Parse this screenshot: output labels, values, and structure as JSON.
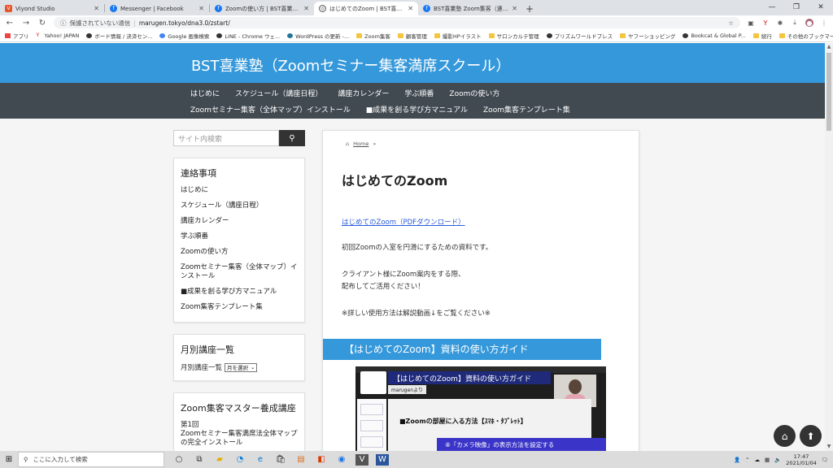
{
  "browser": {
    "tabs": [
      {
        "title": "Viyond Studio",
        "favicon": "V",
        "color": "#e8552d",
        "active": false
      },
      {
        "title": "Messenger | Facebook",
        "favicon": "f",
        "color": "#1877f2",
        "active": false
      },
      {
        "title": "Zoomの使い方 | BST喜業塾（Zoo",
        "favicon": "f",
        "color": "#1877f2",
        "active": false
      },
      {
        "title": "はじめてのZoom | BST喜業塾（Zo",
        "favicon": "◎",
        "color": "#555555",
        "active": true
      },
      {
        "title": "BST喜業塾 Zoom集客（連裂ニコ",
        "favicon": "f",
        "color": "#1877f2",
        "active": false
      }
    ],
    "security": "保護されていない通信",
    "url": "marugen.tokyo/dna3.0/zstart/",
    "bookmarks": [
      "アプリ",
      "Yahoo! JAPAN",
      "ボード情報 / 決済セン...",
      "Google 画像検索",
      "LINE - Chrome ウェ...",
      "WordPress の更新 -...",
      "Zoom集客",
      "顧客管理",
      "撮影HPイラスト",
      "サロンカルテ管理",
      "プリズムワールドプレス",
      "ヤフーショッピング",
      "Bookcat & Global P...",
      "続行",
      "その他のブックマーク"
    ]
  },
  "site": {
    "title": "BST喜業塾（Zoomセミナー集客満席スクール）",
    "nav_row1": [
      "はじめに",
      "スケジュール（講座日程）",
      "講座カレンダー",
      "学ぶ順番",
      "Zoomの使い方"
    ],
    "nav_row2": [
      "Zoomセミナー集客（全体マップ）インストール",
      "■成果を創る学び方マニュアル",
      "Zoom集客テンプレート集"
    ],
    "accent": "#3498db",
    "nav_bg": "#414a51"
  },
  "sidebar": {
    "search_placeholder": "サイト内検索",
    "contact": {
      "heading": "連絡事項",
      "items": [
        "はじめに",
        "スケジュール（講座日程）",
        "講座カレンダー",
        "学ぶ順番",
        "Zoomの使い方",
        "Zoomセミナー集客（全体マップ）インストール",
        "■成果を創る学び方マニュアル",
        "Zoom集客テンプレート集"
      ]
    },
    "monthly": {
      "heading": "月別講座一覧",
      "label": "月別講座一覧",
      "select": "月を選択"
    },
    "master": {
      "heading": "Zoom集客マスター養成講座",
      "items": [
        "第1回",
        "Zoomセミナー集客満席法全体マップの完全インストール"
      ]
    }
  },
  "main": {
    "breadcrumb": {
      "home": "Home",
      "sep": "»"
    },
    "heading": "はじめてのZoom",
    "pdf_link": "はじめてのZoom（PDFダウンロード）",
    "p1": "初回Zoomの入室を円滑にするための資料です。",
    "p2a": "クライアント様にZoom案内をする際、",
    "p2b": "配布してご活用ください！",
    "p3": "※詳しい使用方法は解説動画↓をご覧ください※",
    "band": "【はじめてのZoom】資料の使い方ガイド",
    "video": {
      "title": "【はじめてのZoom】資料の使い方ガイド",
      "tag": "marugenより",
      "sub": "■Zoomの部屋に入る方法【ｽﾏﾎ・ﾀﾌﾞﾚｯﾄ】",
      "step": "⑧「カメラ映像」の表示方法を設定する"
    }
  },
  "taskbar": {
    "search": "ここに入力して検索",
    "time": "17:47",
    "date": "2021/01/04"
  }
}
